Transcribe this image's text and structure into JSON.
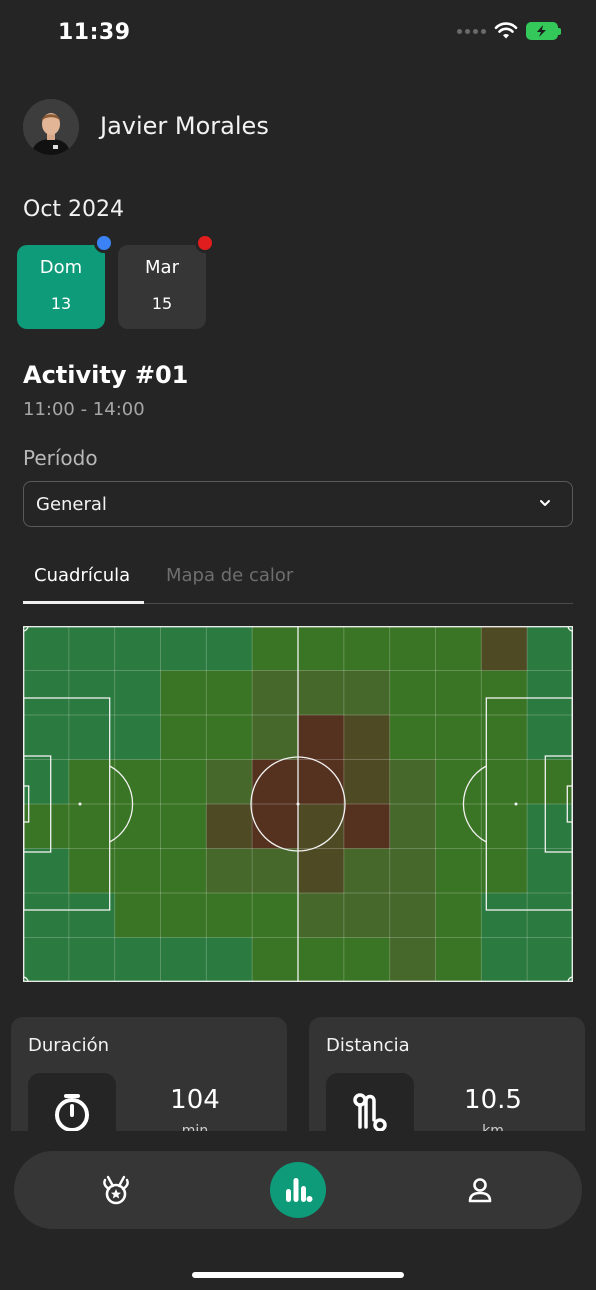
{
  "status_bar": {
    "time": "11:39",
    "icons": [
      "signal-dots-icon",
      "wifi-icon",
      "battery-charging-icon"
    ],
    "battery_color": "#34c759"
  },
  "profile": {
    "name": "Javier Morales",
    "avatar_icon": "player-avatar"
  },
  "calendar": {
    "month": "Oct 2024",
    "days": [
      {
        "name": "Dom",
        "number": "13",
        "selected": true,
        "dot_color": "#3b82f6"
      },
      {
        "name": "Mar",
        "number": "15",
        "selected": false,
        "dot_color": "#e11d1d"
      }
    ],
    "selected_color": "#0e9b79"
  },
  "activity": {
    "title": "Activity #01",
    "time": "11:00 - 14:00"
  },
  "period": {
    "label": "Período",
    "value": "General",
    "icon": "chevron-down-icon"
  },
  "tabs": [
    {
      "label": "Cuadrícula",
      "active": true
    },
    {
      "label": "Mapa de calor",
      "active": false
    }
  ],
  "heatmap": {
    "cols": 12,
    "rows": 8,
    "intensity": [
      [
        0,
        0,
        0,
        0,
        0,
        1,
        1,
        1,
        1,
        1,
        3,
        0
      ],
      [
        0,
        0,
        0,
        1,
        1,
        2,
        2,
        2,
        1,
        1,
        1,
        0
      ],
      [
        0,
        0,
        0,
        1,
        1,
        2,
        4,
        3,
        1,
        1,
        1,
        0
      ],
      [
        0,
        1,
        1,
        1,
        2,
        4,
        4,
        3,
        2,
        1,
        1,
        1
      ],
      [
        1,
        1,
        1,
        1,
        3,
        4,
        3,
        4,
        2,
        1,
        1,
        0
      ],
      [
        0,
        1,
        1,
        1,
        2,
        2,
        3,
        2,
        2,
        1,
        1,
        0
      ],
      [
        0,
        0,
        1,
        1,
        1,
        1,
        2,
        2,
        2,
        1,
        0,
        0
      ],
      [
        0,
        0,
        0,
        0,
        0,
        1,
        1,
        1,
        2,
        1,
        0,
        0
      ]
    ]
  },
  "stats": [
    {
      "title": "Duración",
      "value": "104",
      "unit": "min",
      "icon": "stopwatch-icon"
    },
    {
      "title": "Distancia",
      "value": "10.5",
      "unit": "km",
      "icon": "route-icon"
    }
  ],
  "navbar": {
    "items": [
      {
        "name": "medal-icon",
        "active": false
      },
      {
        "name": "stats-chart-icon",
        "active": true
      },
      {
        "name": "profile-icon",
        "active": false
      }
    ],
    "active_color": "#0e9b79"
  }
}
